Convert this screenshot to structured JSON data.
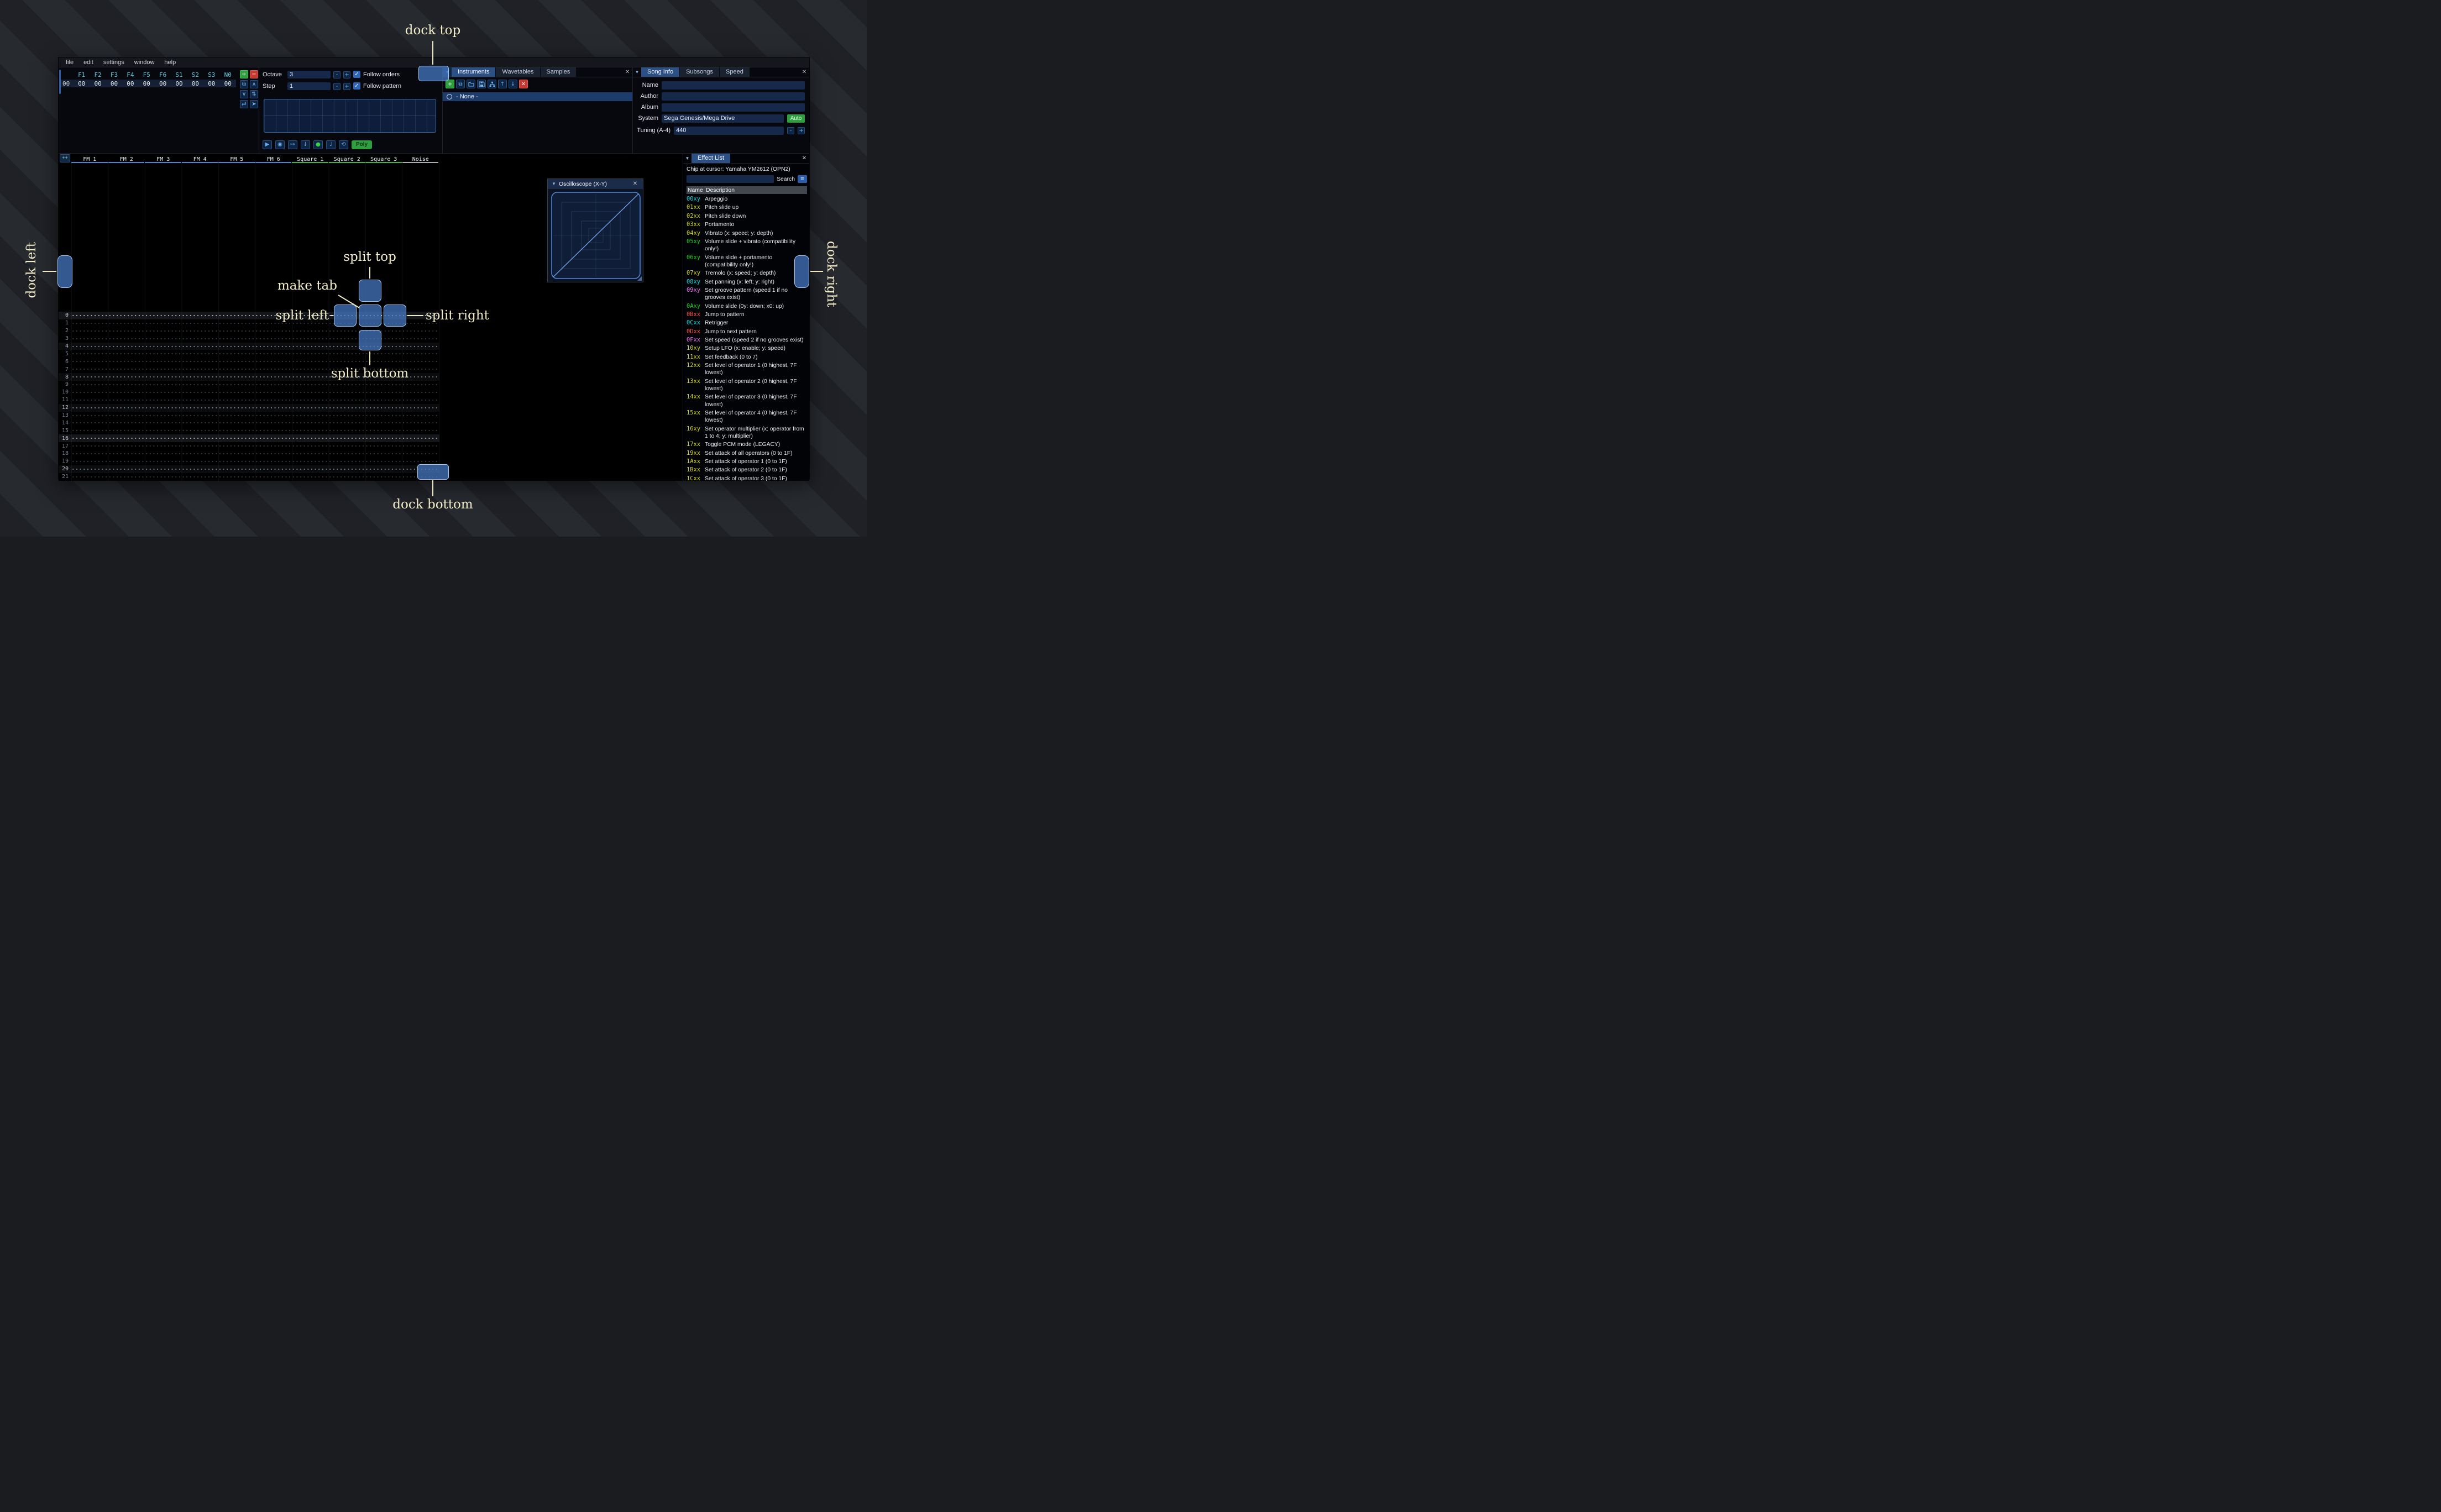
{
  "window": {
    "menu": [
      "file",
      "edit",
      "settings",
      "window",
      "help"
    ]
  },
  "icons": {
    "close": "✕",
    "collapse": "▼",
    "dropdown": "▾",
    "burger": "≡",
    "check": "✓",
    "toolbar_names": [
      "add",
      "duplicate",
      "open",
      "save",
      "organize",
      "move-up",
      "move-down",
      "delete"
    ],
    "plus": "+",
    "copy": "⧉",
    "up": "↑",
    "down": "↓"
  },
  "orders": {
    "headers": [
      "F1",
      "F2",
      "F3",
      "F4",
      "F5",
      "F6",
      "S1",
      "S2",
      "S3",
      "N0"
    ],
    "row_label": "00",
    "row_values": [
      "00",
      "00",
      "00",
      "00",
      "00",
      "00",
      "00",
      "00",
      "00",
      "00"
    ],
    "buttons": [
      {
        "name": "add-order-button",
        "glyph": "+",
        "variant": "g"
      },
      {
        "name": "remove-order-button",
        "glyph": "−",
        "variant": "r"
      },
      {
        "name": "duplicate-order-button",
        "glyph": "⧉",
        "variant": "b"
      },
      {
        "name": "move-order-up-button",
        "glyph": "∧",
        "variant": "b"
      },
      {
        "name": "move-order-down-button",
        "glyph": "∨",
        "variant": "b"
      },
      {
        "name": "duplicate-order-end-button",
        "glyph": "⇅",
        "variant": "b"
      },
      {
        "name": "change-all-orders-button",
        "glyph": "⇄",
        "variant": "b"
      },
      {
        "name": "order-edit-mode-button",
        "glyph": "➤",
        "variant": "b"
      }
    ]
  },
  "transport": {
    "octave_label": "Octave",
    "octave_value": "3",
    "step_label": "Step",
    "step_value": "1",
    "minus": "-",
    "plus": "+",
    "follow_orders": "Follow orders",
    "follow_pattern": "Follow pattern",
    "playback": [
      {
        "name": "play-button",
        "glyph": "▶",
        "variant": ""
      },
      {
        "name": "play-pattern-button",
        "glyph": "◉",
        "variant": ""
      },
      {
        "name": "step-one-row-button",
        "glyph": "↦",
        "variant": ""
      },
      {
        "name": "stop-button",
        "glyph": "↓",
        "variant": ""
      },
      {
        "name": "record-button",
        "glyph": "●",
        "variant": "rec"
      },
      {
        "name": "metronome-button",
        "glyph": "♩",
        "variant": ""
      },
      {
        "name": "repeat-pattern-button",
        "glyph": "⟲",
        "variant": ""
      }
    ],
    "poly_label": "Poly"
  },
  "instruments": {
    "tabs": [
      {
        "label": "Instruments",
        "state": "active"
      },
      {
        "label": "Wavetables",
        "state": ""
      },
      {
        "label": "Samples",
        "state": ""
      }
    ],
    "list_item": "- None -"
  },
  "song_info": {
    "tabs": [
      {
        "label": "Song Info",
        "state": "active"
      },
      {
        "label": "Subsongs",
        "state": ""
      },
      {
        "label": "Speed",
        "state": ""
      }
    ],
    "name_label": "Name",
    "name_value": "",
    "author_label": "Author",
    "author_value": "",
    "album_label": "Album",
    "album_value": "",
    "system_label": "System",
    "system_value": "Sega Genesis/Mega Drive",
    "auto_label": "Auto",
    "tuning_label": "Tuning (A-4)",
    "tuning_value": "440"
  },
  "pattern": {
    "expand_label": "++",
    "channels": [
      {
        "name": "FM 1",
        "state": "fm"
      },
      {
        "name": "FM 2",
        "state": "fm"
      },
      {
        "name": "FM 3",
        "state": "fm"
      },
      {
        "name": "FM 4",
        "state": "fm"
      },
      {
        "name": "FM 5",
        "state": "fm"
      },
      {
        "name": "FM 6",
        "state": "fm"
      },
      {
        "name": "Square 1",
        "state": "square"
      },
      {
        "name": "Square 2",
        "state": "square"
      },
      {
        "name": "Square 3",
        "state": "square"
      },
      {
        "name": "Noise",
        "state": "noise"
      }
    ],
    "rows": [
      {
        "n": "0",
        "s": "hl2"
      },
      {
        "n": "1",
        "s": ""
      },
      {
        "n": "2",
        "s": ""
      },
      {
        "n": "3",
        "s": ""
      },
      {
        "n": "4",
        "s": "hl1"
      },
      {
        "n": "5",
        "s": ""
      },
      {
        "n": "6",
        "s": ""
      },
      {
        "n": "7",
        "s": ""
      },
      {
        "n": "8",
        "s": "hl1"
      },
      {
        "n": "9",
        "s": ""
      },
      {
        "n": "10",
        "s": ""
      },
      {
        "n": "11",
        "s": ""
      },
      {
        "n": "12",
        "s": "hl1"
      },
      {
        "n": "13",
        "s": ""
      },
      {
        "n": "14",
        "s": ""
      },
      {
        "n": "15",
        "s": ""
      },
      {
        "n": "16",
        "s": "hl2"
      },
      {
        "n": "17",
        "s": ""
      },
      {
        "n": "18",
        "s": ""
      },
      {
        "n": "19",
        "s": ""
      },
      {
        "n": "20",
        "s": "hl1"
      },
      {
        "n": "21",
        "s": ""
      }
    ]
  },
  "effects": {
    "tab": "Effect List",
    "chip_line": "Chip at cursor: Yamaha YM2612 (OPN2)",
    "search_value": "",
    "search_label": "Search",
    "header": {
      "name": "Name",
      "description": "Description"
    },
    "colors": {
      "cyan": "#00dfe0",
      "yellow": "#d4d414",
      "green": "#19cf19",
      "magenta": "#ee71ee",
      "red": "#ff4c41"
    },
    "rows": [
      {
        "code": "00xy",
        "color": "cyan",
        "desc": "Arpeggio"
      },
      {
        "code": "01xx",
        "color": "yellow",
        "desc": "Pitch slide up"
      },
      {
        "code": "02xx",
        "color": "yellow",
        "desc": "Pitch slide down"
      },
      {
        "code": "03xx",
        "color": "yellow",
        "desc": "Portamento"
      },
      {
        "code": "04xy",
        "color": "yellow",
        "desc": "Vibrato (x: speed; y: depth)"
      },
      {
        "code": "05xy",
        "color": "green",
        "desc": "Volume slide + vibrato (compatibility only!)"
      },
      {
        "code": "06xy",
        "color": "green",
        "desc": "Volume slide + portamento (compatibility only!)"
      },
      {
        "code": "07xy",
        "color": "yellow",
        "desc": "Tremolo (x: speed; y: depth)"
      },
      {
        "code": "08xy",
        "color": "cyan",
        "desc": "Set panning (x: left; y: right)"
      },
      {
        "code": "09xy",
        "color": "magenta",
        "desc": "Set groove pattern (speed 1 if no grooves exist)"
      },
      {
        "code": "0Axy",
        "color": "green",
        "desc": "Volume slide (0y: down; x0: up)"
      },
      {
        "code": "0Bxx",
        "color": "red",
        "desc": "Jump to pattern"
      },
      {
        "code": "0Cxx",
        "color": "cyan",
        "desc": "Retrigger"
      },
      {
        "code": "0Dxx",
        "color": "red",
        "desc": "Jump to next pattern"
      },
      {
        "code": "0Fxx",
        "color": "magenta",
        "desc": "Set speed (speed 2 if no grooves exist)"
      },
      {
        "code": "10xy",
        "color": "yellow",
        "desc": "Setup LFO (x: enable; y: speed)"
      },
      {
        "code": "11xx",
        "color": "yellow",
        "desc": "Set feedback (0 to 7)"
      },
      {
        "code": "12xx",
        "color": "yellow",
        "desc": "Set level of operator 1 (0 highest, 7F lowest)"
      },
      {
        "code": "13xx",
        "color": "yellow",
        "desc": "Set level of operator 2 (0 highest, 7F lowest)"
      },
      {
        "code": "14xx",
        "color": "yellow",
        "desc": "Set level of operator 3 (0 highest, 7F lowest)"
      },
      {
        "code": "15xx",
        "color": "yellow",
        "desc": "Set level of operator 4 (0 highest, 7F lowest)"
      },
      {
        "code": "16xy",
        "color": "yellow",
        "desc": "Set operator multiplier (x: operator from 1 to 4; y: multiplier)"
      },
      {
        "code": "17xx",
        "color": "yellow",
        "desc": "Toggle PCM mode (LEGACY)"
      },
      {
        "code": "19xx",
        "color": "yellow",
        "desc": "Set attack of all operators (0 to 1F)"
      },
      {
        "code": "1Axx",
        "color": "yellow",
        "desc": "Set attack of operator 1 (0 to 1F)"
      },
      {
        "code": "1Bxx",
        "color": "yellow",
        "desc": "Set attack of operator 2 (0 to 1F)"
      },
      {
        "code": "1Cxx",
        "color": "yellow",
        "desc": "Set attack of operator 3 (0 to 1F)"
      }
    ]
  },
  "oscilloscope": {
    "title": "Oscilloscope (X-Y)"
  },
  "overlay": {
    "color": "#f2ecc8",
    "accent": "#4d7fc9",
    "labels": {
      "dock_top": "dock top",
      "dock_bottom": "dock bottom",
      "dock_left": "dock left",
      "dock_right": "dock right",
      "split_top": "split top",
      "split_bottom": "split bottom",
      "split_left": "split left",
      "split_right": "split right",
      "make_tab": "make tab"
    }
  }
}
